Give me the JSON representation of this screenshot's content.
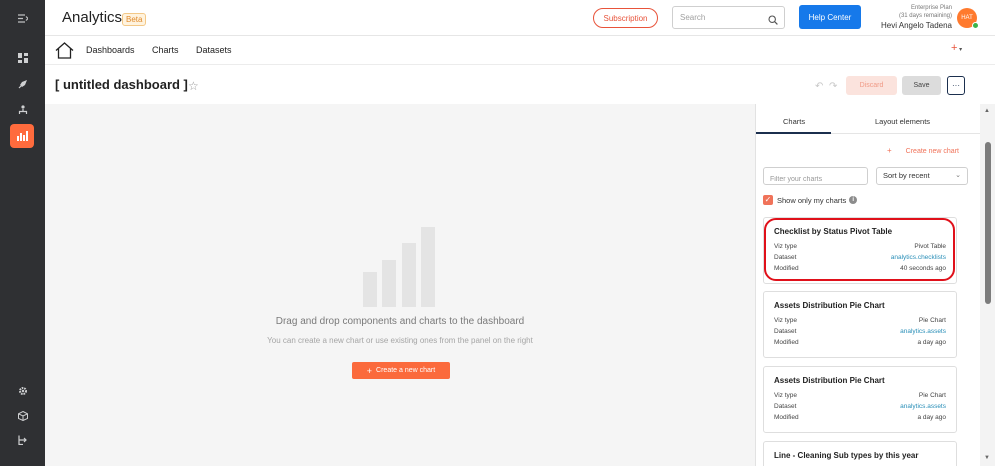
{
  "app": {
    "title": "Analytics",
    "badge": "Beta"
  },
  "header": {
    "subscription_label": "Subscription",
    "search_placeholder": "Search",
    "help_label": "Help Center",
    "plan_name": "Enterprise Plan",
    "plan_remaining": "(31 days remaining)",
    "user_name": "Hevi Angelo Tadena",
    "avatar_initials": "HAT"
  },
  "nav": {
    "links": [
      "Dashboards",
      "Charts",
      "Datasets"
    ],
    "add_symbol": "+"
  },
  "dashboard": {
    "title": "[ untitled dashboard ]",
    "discard_label": "Discard",
    "save_label": "Save",
    "more_label": "···"
  },
  "canvas": {
    "empty_title": "Drag and drop components and charts to the dashboard",
    "empty_subtitle": "You can create a new chart or use existing ones from the panel on the right",
    "create_button": "Create a new chart"
  },
  "panel": {
    "tabs": [
      "Charts",
      "Layout elements"
    ],
    "active_tab": "Charts",
    "create_new_chart": "Create new chart",
    "filter_placeholder": "Filter your charts",
    "sort_value": "Sort by recent",
    "show_only_mine": "Show only my charts",
    "show_only_mine_checked": true,
    "row_labels": {
      "viz": "Viz type",
      "dataset": "Dataset",
      "modified": "Modified"
    },
    "cards": [
      {
        "title": "Checklist by Status Pivot Table",
        "viz_type": "Pivot Table",
        "dataset": "analytics.checklists",
        "modified": "40 seconds ago",
        "highlighted": true
      },
      {
        "title": "Assets Distribution Pie Chart",
        "viz_type": "Pie Chart",
        "dataset": "analytics.assets",
        "modified": "a day ago"
      },
      {
        "title": "Assets Distribution Pie Chart",
        "viz_type": "Pie Chart",
        "dataset": "analytics.assets",
        "modified": "a day ago"
      },
      {
        "title": "Line - Cleaning Sub types by this year"
      }
    ]
  },
  "colors": {
    "accent": "#fb6a3c",
    "primary": "#1679ea",
    "rail": "#2f3033",
    "link": "#2a8fb8",
    "highlight": "#e0101a"
  }
}
